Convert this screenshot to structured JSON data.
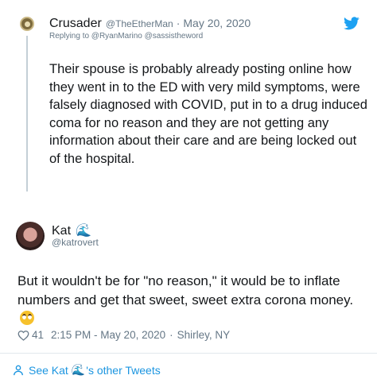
{
  "parent_tweet": {
    "display_name": "Crusader",
    "handle": "@TheEtherMan",
    "separator": "·",
    "date": "May 20, 2020",
    "replying_to": "Replying to @RyanMarino @sassistheword",
    "text": "Their spouse is probably already posting online how they went in to the ED with very mild symptoms, were falsely diagnosed with COVID, put in to a drug induced coma for no reason and they are not getting any information about their care and are being locked out of the hospital."
  },
  "reply_tweet": {
    "display_name": "Kat",
    "name_emoji": "🌊",
    "handle": "@katrovert",
    "text": "But it wouldn't be for \"no reason,\" it would be to inflate numbers and get that sweet, sweet extra corona money.",
    "text_emoji": "eye-roll-emoji",
    "likes": "41",
    "time": "2:15 PM - May 20, 2020",
    "meta_separator": "·",
    "location": "Shirley, NY"
  },
  "footer": {
    "see_prefix": "See Kat",
    "emoji": "🌊",
    "see_suffix": "'s other Tweets"
  },
  "icons": {
    "twitter_logo": "twitter-bird-icon",
    "like": "heart-icon",
    "footer": "person-icon"
  },
  "colors": {
    "twitter_blue": "#1da1f2",
    "link_blue": "#1b95e0",
    "secondary_text": "#657786",
    "primary_text": "#14171a",
    "thread_line": "#c4cfd6",
    "divider": "#e1e8ed"
  }
}
